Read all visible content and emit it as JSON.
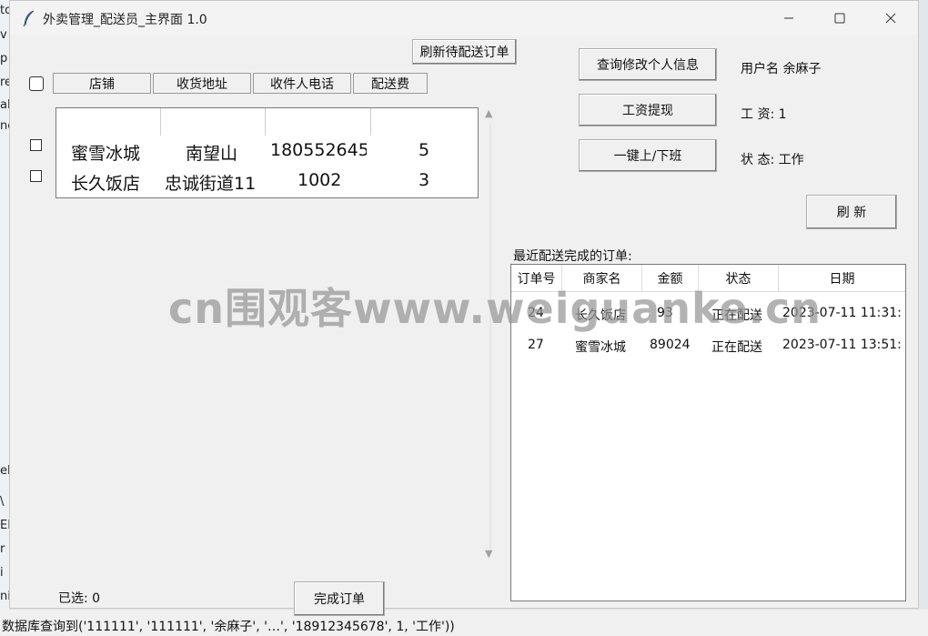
{
  "background": {
    "left_fragments": [
      "to",
      "v",
      "p",
      "re",
      "al",
      "ne"
    ],
    "left_fragments_lower": [
      "el",
      "\\",
      "EL",
      "r",
      "i",
      "迸",
      "ni"
    ],
    "bottom_text": "数据库查询到('111111', '111111', '余麻子', '…', '18912345678', 1, '工作'))"
  },
  "window": {
    "title": "外卖管理_配送员_主界面 1.0"
  },
  "toolbar": {
    "refresh_pending_label": "刷新待配送订单"
  },
  "pending": {
    "headers": [
      "店铺",
      "收货地址",
      "收件人电话",
      "配送费"
    ],
    "rows": [
      {
        "shop": "蜜雪冰城",
        "address": "南望山",
        "phone": "180552645",
        "fee": "5"
      },
      {
        "shop": "长久饭店",
        "address": "忠诚街道11",
        "phone": "1002",
        "fee": "3"
      }
    ],
    "selected_label": "已选: 0",
    "complete_label": "完成订单"
  },
  "actions": {
    "edit_profile_label": "查询修改个人信息",
    "withdraw_label": "工资提现",
    "toggle_shift_label": "一键上/下班",
    "refresh_label": "刷 新"
  },
  "user": {
    "name_label": "用户名",
    "name": "余麻子",
    "salary_label": "工 资:",
    "salary": "1",
    "status_label": "状 态:",
    "status": "工作"
  },
  "recent": {
    "title": "最近配送完成的订单:",
    "headers": [
      "订单号",
      "商家名",
      "金额",
      "状态",
      "日期"
    ],
    "rows": [
      {
        "id": "24",
        "shop": "长久饭店",
        "amount": "93",
        "state": "正在配送",
        "date": "2023-07-11 11:31:"
      },
      {
        "id": "27",
        "shop": "蜜雪冰城",
        "amount": "89024",
        "state": "正在配送",
        "date": "2023-07-11 13:51:"
      }
    ]
  },
  "watermark": "cn围观客www.weiguanke.cn",
  "colors": {
    "window_bg": "#f0f0f0",
    "list_bg": "#ffffff",
    "border": "#7a7a7a",
    "watermark": "#969696"
  }
}
